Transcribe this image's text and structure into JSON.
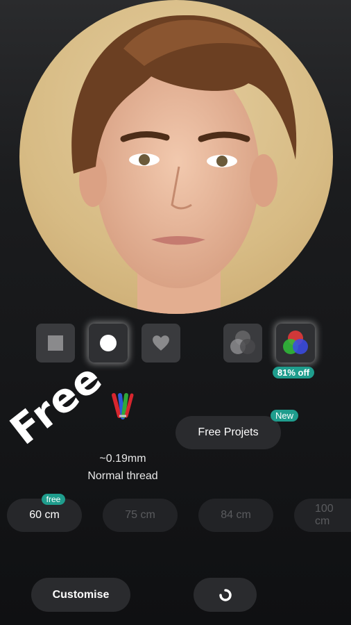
{
  "shape_options": [
    {
      "name": "square",
      "selected": false
    },
    {
      "name": "circle",
      "selected": true
    },
    {
      "name": "heart",
      "selected": false
    }
  ],
  "color_options": [
    {
      "name": "grayscale",
      "selected": false
    },
    {
      "name": "color",
      "selected": true,
      "badge": "81% off"
    }
  ],
  "thread": {
    "size": "~0.19mm",
    "type": "Normal thread",
    "icon": "thread-spools-icon"
  },
  "free_projects": {
    "label": "Free Projets",
    "badge": "New"
  },
  "free_stamp": "Free",
  "sizes": [
    {
      "label": "60 cm",
      "badge": "free",
      "selected": true
    },
    {
      "label": "75 cm",
      "selected": false
    },
    {
      "label": "84 cm",
      "selected": false
    },
    {
      "label": "100 cm",
      "selected": false
    }
  ],
  "actions": {
    "customise_label": "Customise",
    "loading_icon": "spinner-icon"
  },
  "colors": {
    "accent": "#1f9d8d",
    "background": "#1b1c1e"
  }
}
